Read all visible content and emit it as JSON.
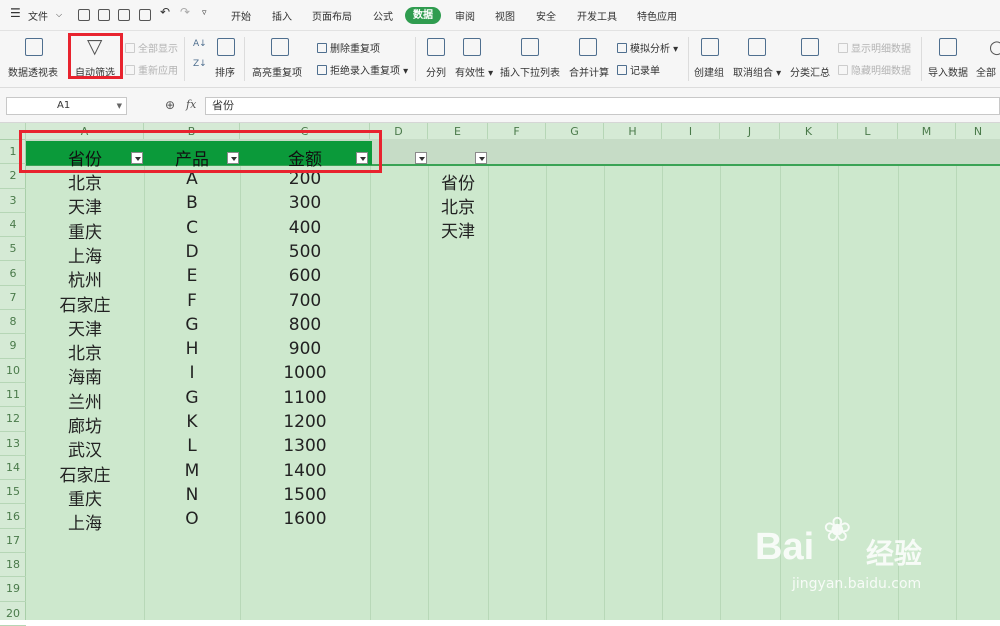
{
  "menu": {
    "file": "文件",
    "tabs": [
      "开始",
      "插入",
      "页面布局",
      "公式",
      "数据",
      "审阅",
      "视图",
      "安全",
      "开发工具",
      "特色应用"
    ],
    "active_tab": "数据"
  },
  "ribbon": {
    "pivot": "数据透视表",
    "autofilter": "自动筛选",
    "show_all": "全部显示",
    "reapply": "重新应用",
    "sort": "排序",
    "highlight_dup": "高亮重复项",
    "remove_dup": "删除重复项",
    "reject_dup": "拒绝录入重复项",
    "split": "分列",
    "validity": "有效性",
    "dropdown_list": "插入下拉列表",
    "consolidate": "合并计算",
    "simulate": "模拟分析",
    "record": "记录单",
    "create_group": "创建组",
    "ungroup": "取消组合",
    "subtotal": "分类汇总",
    "show_detail": "显示明细数据",
    "hide_detail": "隐藏明细数据",
    "import": "导入数据",
    "all": "全部"
  },
  "formula_bar": {
    "cell_ref": "A1",
    "fx": "fx",
    "value": "省份"
  },
  "columns": [
    "A",
    "B",
    "C",
    "D",
    "E",
    "F",
    "G",
    "H",
    "I",
    "J",
    "K",
    "L",
    "M",
    "N"
  ],
  "rows": [
    "1",
    "2",
    "3",
    "4",
    "5",
    "6",
    "7",
    "8",
    "9",
    "10",
    "11",
    "12",
    "13",
    "14",
    "15",
    "16",
    "17",
    "18",
    "19",
    "20"
  ],
  "header": {
    "a": "省份",
    "b": "产品",
    "c": "金额"
  },
  "table": [
    {
      "a": "北京",
      "b": "A",
      "c": "200"
    },
    {
      "a": "天津",
      "b": "B",
      "c": "300"
    },
    {
      "a": "重庆",
      "b": "C",
      "c": "400"
    },
    {
      "a": "上海",
      "b": "D",
      "c": "500"
    },
    {
      "a": "杭州",
      "b": "E",
      "c": "600"
    },
    {
      "a": "石家庄",
      "b": "F",
      "c": "700"
    },
    {
      "a": "天津",
      "b": "G",
      "c": "800"
    },
    {
      "a": "北京",
      "b": "H",
      "c": "900"
    },
    {
      "a": "海南",
      "b": "I",
      "c": "1000"
    },
    {
      "a": "兰州",
      "b": "G",
      "c": "1100"
    },
    {
      "a": "廊坊",
      "b": "K",
      "c": "1200"
    },
    {
      "a": "武汉",
      "b": "L",
      "c": "1300"
    },
    {
      "a": "石家庄",
      "b": "M",
      "c": "1400"
    },
    {
      "a": "重庆",
      "b": "N",
      "c": "1500"
    },
    {
      "a": "上海",
      "b": "O",
      "c": "1600"
    }
  ],
  "criteria": [
    "省份",
    "北京",
    "天津"
  ],
  "watermark": {
    "brand": "Bai",
    "brand_cn": "经验",
    "url": "jingyan.baidu.com"
  },
  "colors": {
    "accent": "#2f9c4f",
    "highlight": "#e8232e",
    "header_fill": "#0b9a3a",
    "sheet_bg": "#cde8cd"
  }
}
